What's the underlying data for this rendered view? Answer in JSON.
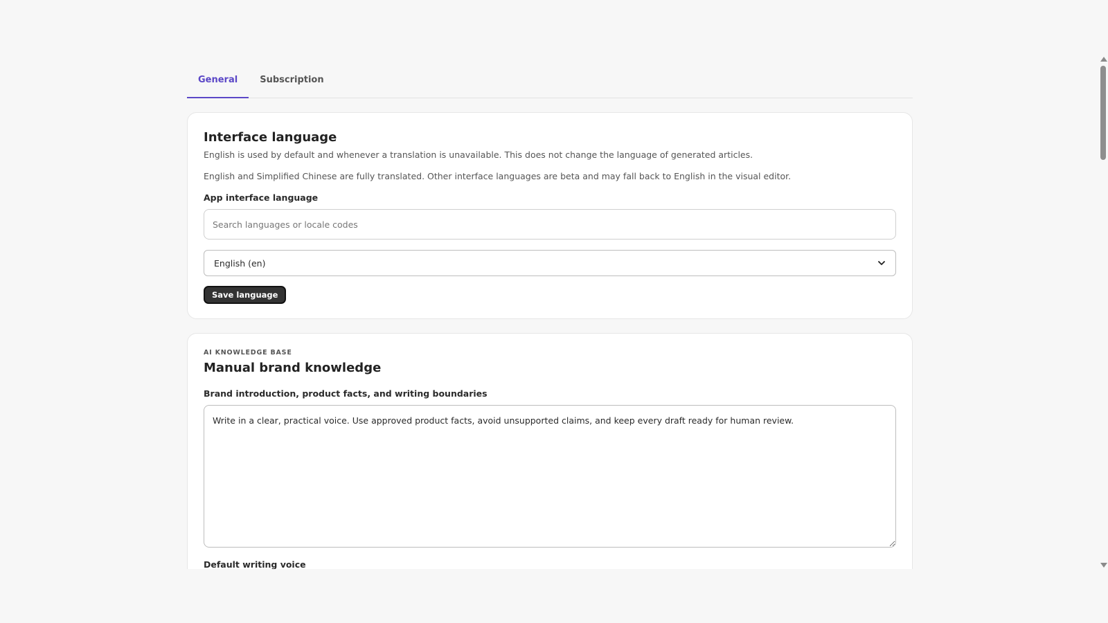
{
  "tabs": [
    {
      "label": "General",
      "active": true
    },
    {
      "label": "Subscription",
      "active": false
    }
  ],
  "interface_language": {
    "title": "Interface language",
    "description_1": "English is used by default and whenever a translation is unavailable. This does not change the language of generated articles.",
    "description_2": "English and Simplified Chinese are fully translated. Other interface languages are beta and may fall back to English in the visual editor.",
    "field_label": "App interface language",
    "search_placeholder": "Search languages or locale codes",
    "search_value": "",
    "selected_language": "English (en)",
    "save_label": "Save language"
  },
  "knowledge_base": {
    "eyebrow": "AI KNOWLEDGE BASE",
    "title": "Manual brand knowledge",
    "brand_field_label": "Brand introduction, product facts, and writing boundaries",
    "brand_text": "Write in a clear, practical voice. Use approved product facts, avoid unsupported claims, and keep every draft ready for human review.",
    "voice_field_label": "Default writing voice"
  },
  "colors": {
    "accent": "#5b47c7",
    "page_background": "#f7f7f7",
    "button_dark": "#333333"
  },
  "icons": {
    "select_chevron": "chevron-down-icon",
    "scroll_up": "triangle-up-icon",
    "scroll_down": "triangle-down-icon"
  }
}
